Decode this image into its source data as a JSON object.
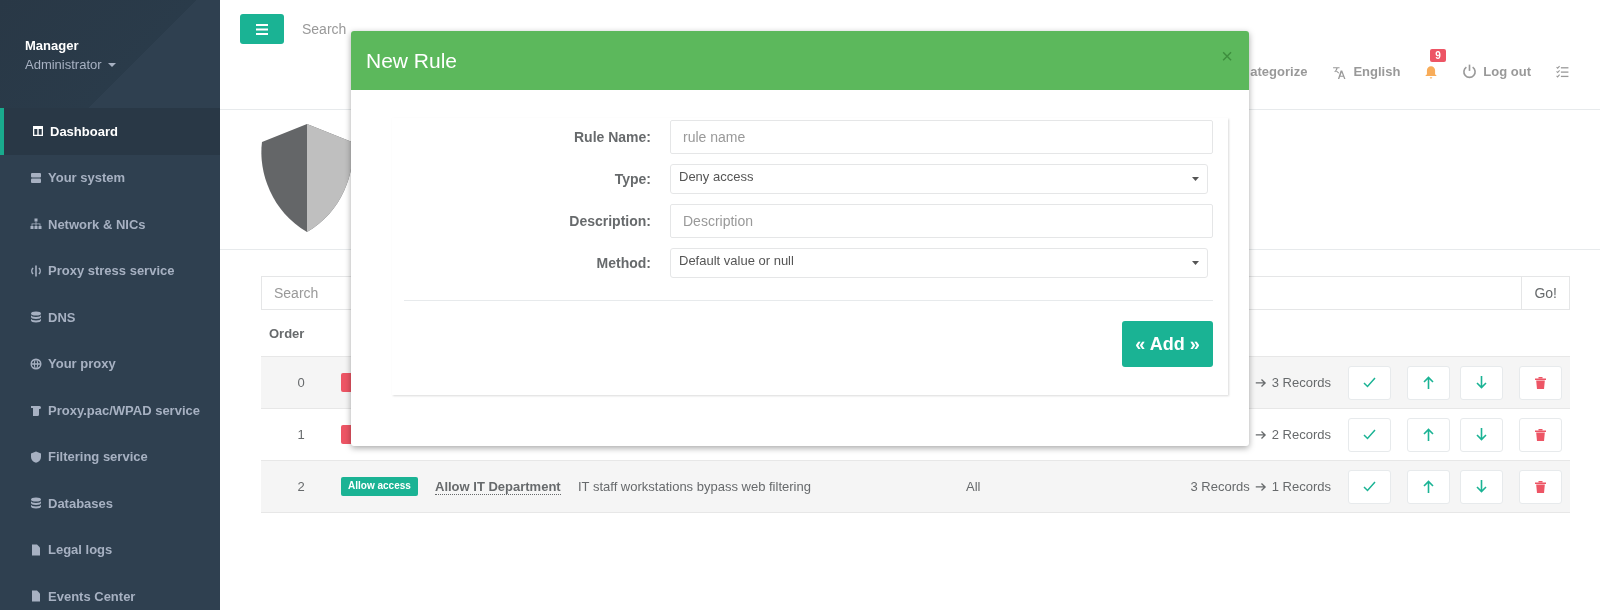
{
  "sidebar": {
    "user": {
      "name": "Manager",
      "role": "Administrator"
    },
    "items": [
      {
        "label": "Dashboard",
        "selected": true
      },
      {
        "label": "Your system",
        "selected": false
      },
      {
        "label": "Network & NICs",
        "selected": false
      },
      {
        "label": "Proxy stress service",
        "selected": false
      },
      {
        "label": "DNS",
        "selected": false
      },
      {
        "label": "Your proxy",
        "selected": false
      },
      {
        "label": "Proxy.pac/WPAD service",
        "selected": false
      },
      {
        "label": "Filtering service",
        "selected": false
      },
      {
        "label": "Databases",
        "selected": false
      },
      {
        "label": "Legal logs",
        "selected": false
      },
      {
        "label": "Events Center",
        "selected": false
      }
    ]
  },
  "topbar": {
    "search_placeholder": "Search",
    "nav": [
      {
        "kind": "text",
        "label": "ategorize"
      },
      {
        "kind": "language",
        "label": "English"
      },
      {
        "kind": "notifications",
        "badge": "9"
      },
      {
        "kind": "logout",
        "label": "Log out"
      },
      {
        "kind": "tasks"
      }
    ]
  },
  "filter": {
    "placeholder": "Search",
    "button": "Go!"
  },
  "table": {
    "columns": [
      "Order"
    ],
    "rows": [
      {
        "order": "0",
        "tag": {
          "kind": "deny"
        },
        "records_to": "3 Records"
      },
      {
        "order": "1",
        "tag": {
          "kind": "deny"
        },
        "records_to": "2 Records"
      },
      {
        "order": "2",
        "tag": {
          "kind": "allow",
          "label": "Allow access"
        },
        "name": "Allow IT Department",
        "description": "IT staff workstations bypass web filtering",
        "method": "All",
        "records_from": "3 Records",
        "records_to": "1 Records"
      }
    ]
  },
  "modal": {
    "title": "New Rule",
    "close": "×",
    "fields": [
      {
        "kind": "input",
        "label": "Rule Name:",
        "placeholder": "rule name"
      },
      {
        "kind": "select",
        "label": "Type:",
        "value": "Deny access"
      },
      {
        "kind": "input",
        "label": "Description:",
        "placeholder": "Description"
      },
      {
        "kind": "select",
        "label": "Method:",
        "value": "Default value or null"
      }
    ],
    "submit": "« Add »"
  }
}
